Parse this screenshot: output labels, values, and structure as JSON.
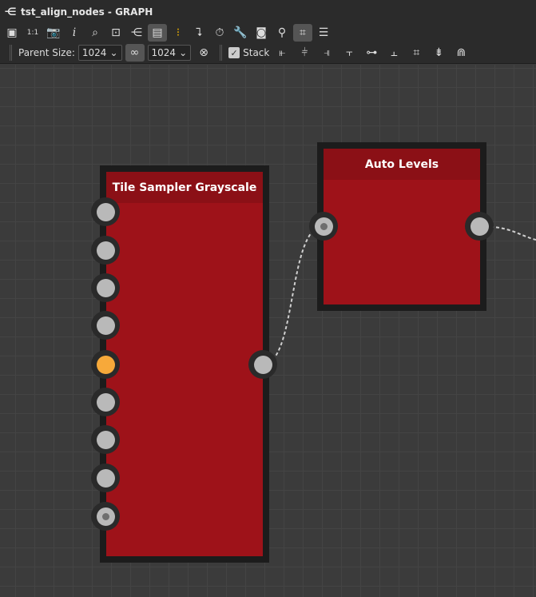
{
  "title": "tst_align_nodes - GRAPH",
  "toolbar": {
    "parent_size_label": "Parent Size:",
    "width_value": "1024",
    "height_value": "1024",
    "stack_label": "Stack",
    "stack_checked": true
  },
  "nodes": [
    {
      "title": "Tile Sampler Grayscale",
      "input_count": 9,
      "highlight_input": 5
    },
    {
      "title": "Auto Levels",
      "input_count": 1
    }
  ],
  "colors": {
    "node_body": "#9e1219",
    "node_header": "#8b1016",
    "highlight_port": "#f7a93a"
  }
}
